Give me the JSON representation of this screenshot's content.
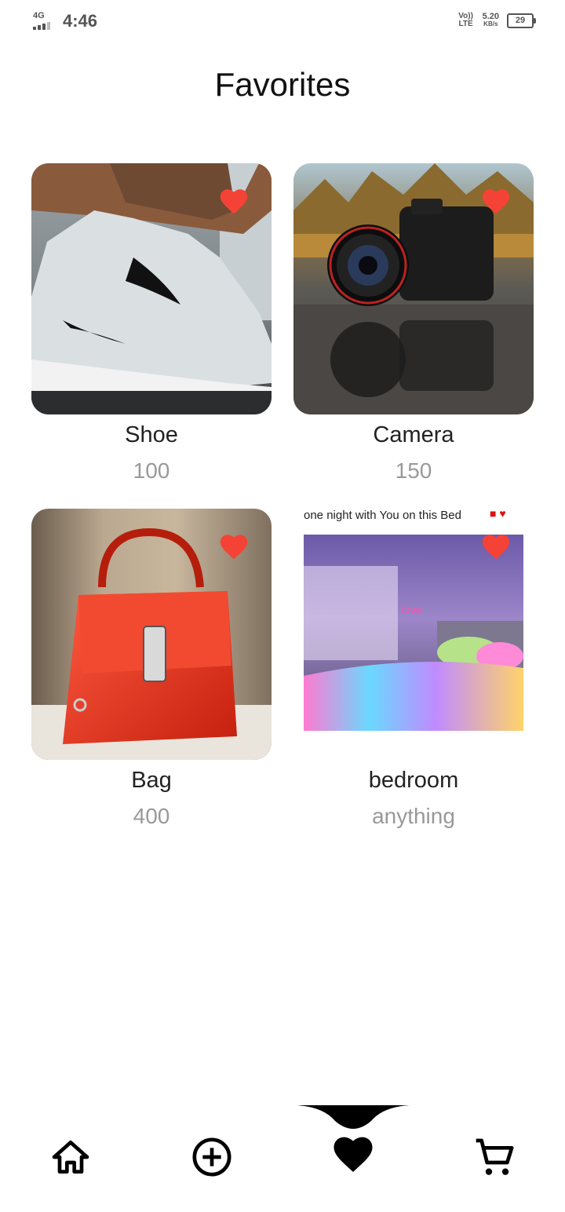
{
  "status_bar": {
    "network": "4G",
    "time": "4:46",
    "volte": "Vo)) LTE",
    "speed_value": "5.20",
    "speed_unit": "KB/s",
    "battery": "29"
  },
  "page": {
    "title": "Favorites"
  },
  "items": [
    {
      "name": "Shoe",
      "price": "100",
      "image": "shoe-photo"
    },
    {
      "name": "Camera",
      "price": "150",
      "image": "camera-photo"
    },
    {
      "name": "Bag",
      "price": "400",
      "image": "bag-photo"
    },
    {
      "name": "bedroom",
      "price": "anything",
      "image": "bedroom-screenshot",
      "image_caption": "one night with You on this Bed"
    }
  ],
  "nav": {
    "items": [
      "home-icon",
      "add-circle-icon",
      "heart-icon",
      "cart-icon"
    ],
    "active": "heart-icon"
  },
  "colors": {
    "heart": "#f44336",
    "nav_icon": "#000000",
    "title": "#111111",
    "price": "#999999"
  }
}
